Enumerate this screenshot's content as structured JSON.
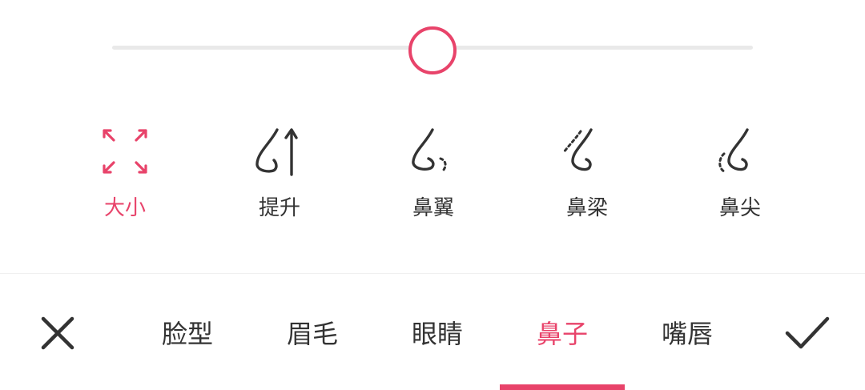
{
  "slider": {
    "value_fraction": 0.5
  },
  "tools": [
    {
      "label": "大小",
      "icon": "resize-arrows-icon",
      "active": true
    },
    {
      "label": "提升",
      "icon": "nose-lift-icon",
      "active": false
    },
    {
      "label": "鼻翼",
      "icon": "nose-wing-icon",
      "active": false
    },
    {
      "label": "鼻梁",
      "icon": "nose-bridge-icon",
      "active": false
    },
    {
      "label": "鼻尖",
      "icon": "nose-tip-icon",
      "active": false
    }
  ],
  "tabs": [
    {
      "label": "脸型",
      "active": false
    },
    {
      "label": "眉毛",
      "active": false
    },
    {
      "label": "眼睛",
      "active": false
    },
    {
      "label": "鼻子",
      "active": true
    },
    {
      "label": "嘴唇",
      "active": false
    }
  ],
  "actions": {
    "cancel_icon": "close-icon",
    "confirm_icon": "check-icon"
  },
  "colors": {
    "accent": "#e8436a",
    "text": "#333333",
    "track": "#e9e9e9"
  }
}
